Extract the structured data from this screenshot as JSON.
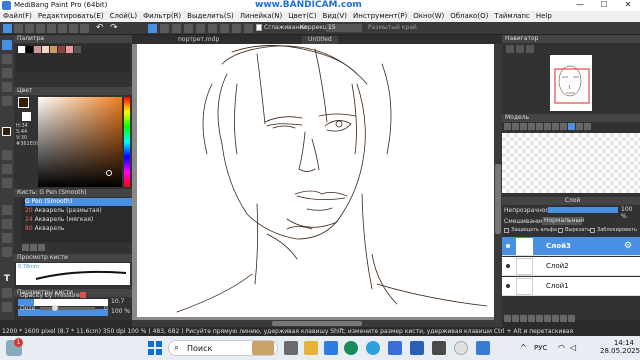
{
  "window": {
    "title": "MediBang Paint Pro (64bit)",
    "watermark": "www.BANDICAM.com",
    "min": "—",
    "max": "☐",
    "close": "✕"
  },
  "menu": [
    "Файл(F)",
    "Редактировать(E)",
    "Слой(L)",
    "Фильтр(R)",
    "Выделить(S)",
    "Линейка(N)",
    "Цвет(C)",
    "Вид(V)",
    "Инструмент(P)",
    "Окно(W)",
    "Облако(O)",
    "Таймлапс",
    "Help"
  ],
  "toolbar": {
    "smoothing_label": "Сглаживание",
    "correction_label": "Коррекция",
    "correction_value": "15",
    "snap_label": "Размытый край"
  },
  "tabs": [
    {
      "label": "портрет.mdp"
    },
    {
      "label": "Untitled"
    }
  ],
  "left": {
    "palette_title": "Палитра",
    "color_title": "Цвет",
    "hsv": [
      "H:34",
      "S:44",
      "V:30"
    ],
    "hex": "#361E09",
    "brush_title": "Кисть: G Pen (Smooth)",
    "brushes": [
      {
        "size": "",
        "name": "G Pen (Smooth)"
      },
      {
        "size": "20",
        "name": "Акварель (размытая)"
      },
      {
        "size": "24",
        "name": "Акварель (мягкая)"
      },
      {
        "size": "80",
        "name": "Акварель"
      }
    ],
    "preview_title": "Просмотр кисти",
    "preview_size": "0.78mm",
    "params_title": "Параметры кисти",
    "size_value": "10.7",
    "opacity_value": "100 %",
    "opacity_pressure": "Opacity by Pressure",
    "ooze_label": "Ooze",
    "ooze_value": "0"
  },
  "right": {
    "navigator_title": "Навигатор",
    "models_title": "Модель",
    "layer_title": "Слой",
    "opacity_label": "Непрозрачность",
    "opacity_value": "100 %",
    "blend_label": "Смешивание",
    "blend_value": "Нормальный",
    "protect_alpha": "Защищать альфа",
    "clip": "Вырезать",
    "lock": "Заблокировать",
    "layers": [
      {
        "name": "Слой3",
        "selected": true
      },
      {
        "name": "Слой2",
        "selected": false
      },
      {
        "name": "Слой1",
        "selected": false
      }
    ]
  },
  "status": "1200 * 1600 pixel   (8.7 * 11.6cm)   350 dpi   100 %   ( 483, 682 )   Рисуйте прямую линию, удерживая клавишу Shift; измените размер кисти, удерживая клавиши Ctrl + Alt и перетаскивая",
  "taskbar": {
    "search": "Поиск",
    "lang": "РУС",
    "time": "14:14",
    "date": "28.05.2025",
    "badge": "1"
  },
  "colors": {
    "accent": "#4a90e2",
    "ink": "#3b2414",
    "fg": "#361e09",
    "bg": "#ffffff"
  }
}
